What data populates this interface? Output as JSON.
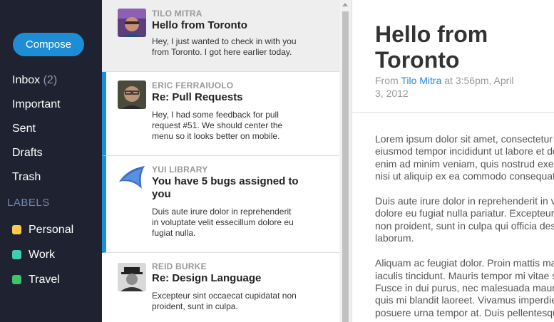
{
  "nav": {
    "compose_label": "Compose",
    "items": [
      {
        "label": "Inbox",
        "count": "(2)"
      },
      {
        "label": "Important"
      },
      {
        "label": "Sent"
      },
      {
        "label": "Drafts"
      },
      {
        "label": "Trash"
      }
    ],
    "labels_heading": "LABELS",
    "labels": [
      {
        "label": "Personal",
        "color": "#ffc94c"
      },
      {
        "label": "Work",
        "color": "#41ccb4"
      },
      {
        "label": "Travel",
        "color": "#40c365"
      }
    ]
  },
  "messages": [
    {
      "from": "Tilo Mitra",
      "subject": "Hello from Toronto",
      "desc": [
        "Hey, I just wanted to check in with you",
        "from Toronto. I got here earlier today."
      ],
      "selected": true,
      "unread": false
    },
    {
      "from": "Eric Ferraiuolo",
      "subject": "Re: Pull Requests",
      "desc": [
        "Hey, I had some feedback for pull",
        "request #51. We should center the",
        "menu so it looks better on mobile."
      ],
      "selected": false,
      "unread": true
    },
    {
      "from": "YUI Library",
      "subject": [
        "You have 5 bugs assigned to",
        "you"
      ],
      "desc": [
        "Duis aute irure dolor in reprehenderit",
        "in voluptate velit essecillum dolore eu",
        "fugiat nulla."
      ],
      "selected": false,
      "unread": true
    },
    {
      "from": "Reid Burke",
      "subject": "Re: Design Language",
      "desc": [
        "Excepteur sint occaecat cupidatat non",
        "proident, sunt in culpa."
      ],
      "selected": false,
      "unread": false
    }
  ],
  "content": {
    "title": [
      "Hello from",
      "Toronto"
    ],
    "meta_from": "From",
    "meta_author": "Tilo Mitra",
    "meta_at": "at",
    "meta_date_1": "3:56pm, April",
    "meta_date_2": "3, 2012",
    "paragraphs": [
      [
        "Lorem ipsum dolor sit amet, consectetur adipisicing elit, sed do",
        "eiusmod tempor incididunt ut labore et dolore magna aliqua. Ut",
        "enim ad minim veniam, quis nostrud exercitation ullamco laboris",
        "nisi ut aliquip ex ea commodo consequat."
      ],
      [
        "Duis aute irure dolor in reprehenderit in voluptate velit esse cillum",
        "dolore eu fugiat nulla pariatur. Excepteur sint occaecat cupidatat",
        "non proident, sunt in culpa qui officia deserunt mollit anim id est",
        "laborum."
      ],
      [
        "Aliquam ac feugiat dolor. Proin mattis massa sit amet enim",
        "iaculis tincidunt. Mauris tempor mi vitae sem aliquet pharetra.",
        "Fusce in dui purus, nec malesuada mauris. Curabitur ornare arcu",
        "quis mi blandit laoreet. Vivamus imperdiet fermentum mauris, ac",
        "posuere urna tempor at. Duis pellentesque justo ac sapien aliquet"
      ]
    ]
  }
}
